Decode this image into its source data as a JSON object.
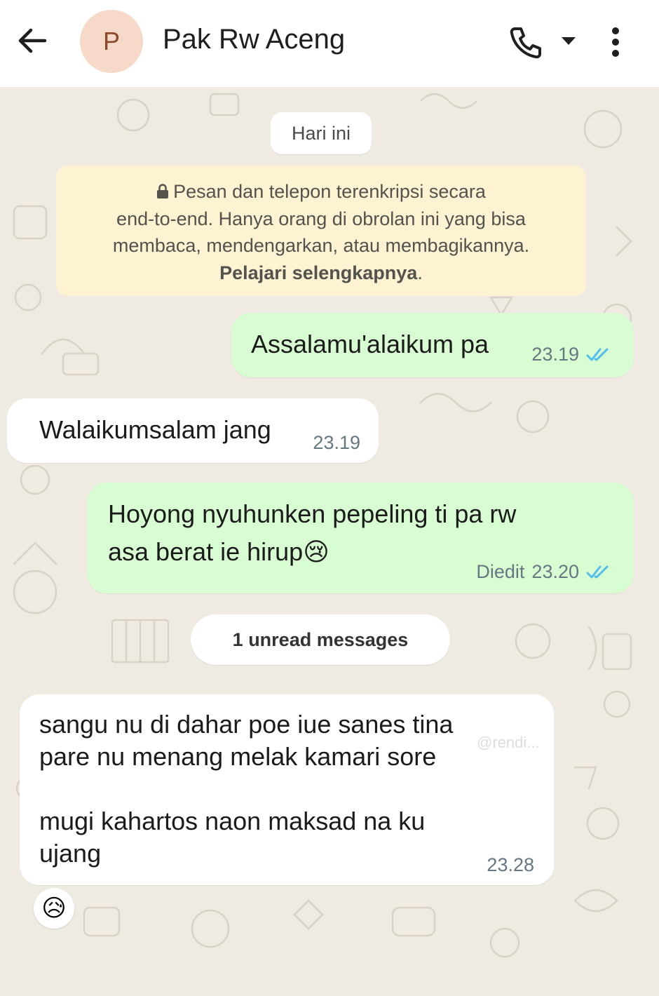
{
  "header": {
    "contact_name": "Pak Rw Aceng",
    "avatar_initial": "P"
  },
  "chat": {
    "date_label": "Hari ini",
    "encryption_notice": {
      "line1": "Pesan dan telepon terenkripsi secara",
      "line2": "end-to-end. Hanya orang di obrolan ini yang bisa",
      "line3": "membaca, mendengarkan, atau membagikannya.",
      "learn_more": "Pelajari selengkapnya",
      "trailing": "."
    },
    "messages": [
      {
        "direction": "outgoing",
        "lines": [
          "Assalamu'alaikum pa"
        ],
        "time": "23.19",
        "status": "read"
      },
      {
        "direction": "incoming",
        "lines": [
          "Walaikumsalam jang"
        ],
        "time": "23.19"
      },
      {
        "direction": "outgoing",
        "lines": [
          "Hoyong nyuhunken pepeling ti pa rw",
          "asa berat ie hirup"
        ],
        "emoji": "😢",
        "edited_label": "Diedit",
        "time": "23.20",
        "status": "read"
      },
      {
        "direction": "incoming",
        "lines": [
          "sangu nu di dahar poe iue sanes tina",
          "pare nu menang melak kamari sore",
          "",
          "mugi kahartos naon maksad na ku",
          "ujang"
        ],
        "time": "23.28",
        "reaction": "😥"
      }
    ],
    "unread_label": "1 unread messages",
    "watermark": "@rendi..."
  },
  "colors": {
    "outgoing_bubble": "#d9fdd3",
    "incoming_bubble": "#ffffff",
    "notice_bg": "#fdf2d2",
    "read_tick": "#53bdeb",
    "chat_bg": "#efeae2"
  },
  "icons": [
    "back-arrow-icon",
    "phone-icon",
    "dropdown-caret-icon",
    "more-vert-icon",
    "lock-icon",
    "double-check-icon"
  ]
}
